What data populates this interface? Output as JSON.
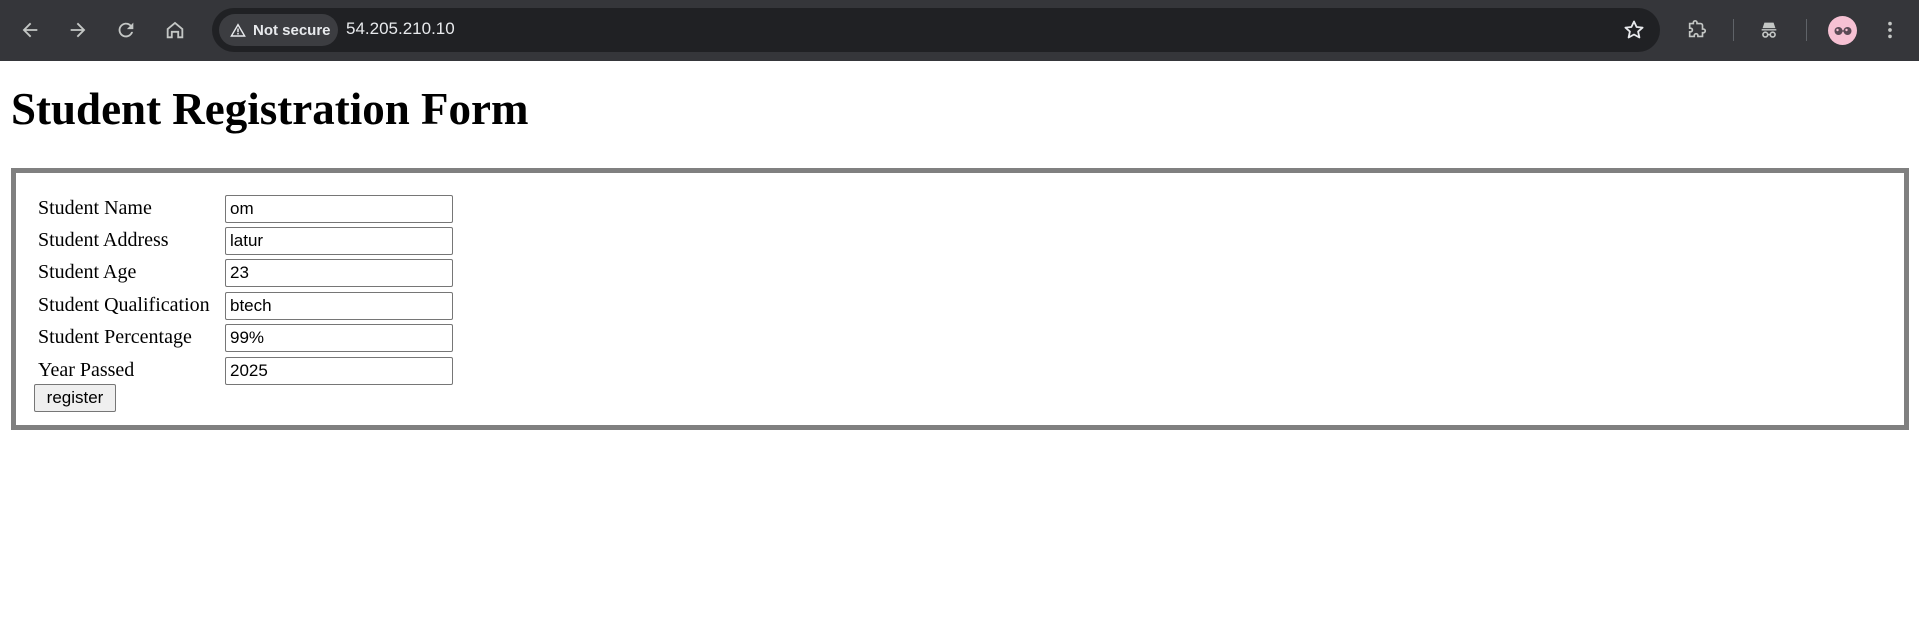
{
  "browser": {
    "security_label": "Not secure",
    "url": "54.205.210.10",
    "icons": [
      "back-icon",
      "forward-icon",
      "reload-icon",
      "home-icon",
      "warning-icon",
      "star-icon",
      "extensions-icon",
      "incognito-icon",
      "avatar",
      "menu-icon"
    ]
  },
  "page": {
    "title": "Student Registration Form"
  },
  "form": {
    "fields": [
      {
        "label": "Student Name",
        "value": "om"
      },
      {
        "label": "Student Address",
        "value": "latur"
      },
      {
        "label": "Student Age",
        "value": "23"
      },
      {
        "label": "Student Qualification",
        "value": "btech"
      },
      {
        "label": "Student Percentage",
        "value": "99%"
      },
      {
        "label": "Year Passed",
        "value": "2025"
      }
    ],
    "submit_label": "register"
  },
  "colors": {
    "toolbar_bg": "#35363a",
    "omnibox_bg": "#202124",
    "form_border": "#808080"
  }
}
